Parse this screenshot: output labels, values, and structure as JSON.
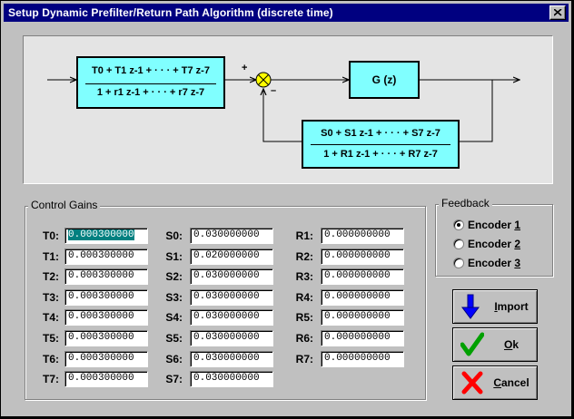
{
  "window": {
    "title": "Setup Dynamic Prefilter/Return Path Algorithm (discrete time)"
  },
  "diagram": {
    "prefilter_num": "T0 + T1 z-1 + · · · + T7 z-7",
    "prefilter_den": "1 + r1 z-1 + · · · + r7 z-7",
    "plant": "G (z)",
    "feedback_num": "S0 + S1 z-1 + · · · + S7 z-7",
    "feedback_den": "1 + R1 z-1 + · · · + R7 z-7",
    "plus_sign": "+",
    "minus_sign": "–",
    "block_color": "#80ffff"
  },
  "control_gains": {
    "label": "Control Gains",
    "T": [
      {
        "label": "T0:",
        "value": "0.000300000"
      },
      {
        "label": "T1:",
        "value": "0.000300000"
      },
      {
        "label": "T2:",
        "value": "0.000300000"
      },
      {
        "label": "T3:",
        "value": "0.000300000"
      },
      {
        "label": "T4:",
        "value": "0.000300000"
      },
      {
        "label": "T5:",
        "value": "0.000300000"
      },
      {
        "label": "T6:",
        "value": "0.000300000"
      },
      {
        "label": "T7:",
        "value": "0.000300000"
      }
    ],
    "S": [
      {
        "label": "S0:",
        "value": "0.030000000"
      },
      {
        "label": "S1:",
        "value": "0.020000000"
      },
      {
        "label": "S2:",
        "value": "0.030000000"
      },
      {
        "label": "S3:",
        "value": "0.030000000"
      },
      {
        "label": "S4:",
        "value": "0.030000000"
      },
      {
        "label": "S5:",
        "value": "0.030000000"
      },
      {
        "label": "S6:",
        "value": "0.030000000"
      },
      {
        "label": "S7:",
        "value": "0.030000000"
      }
    ],
    "R": [
      {
        "label": "R1:",
        "value": "0.000000000"
      },
      {
        "label": "R2:",
        "value": "0.000000000"
      },
      {
        "label": "R3:",
        "value": "0.000000000"
      },
      {
        "label": "R4:",
        "value": "0.000000000"
      },
      {
        "label": "R5:",
        "value": "0.000000000"
      },
      {
        "label": "R6:",
        "value": "0.000000000"
      },
      {
        "label": "R7:",
        "value": "0.000000000"
      }
    ]
  },
  "feedback": {
    "label": "Feedback",
    "options": [
      {
        "text": "Encoder ",
        "key": "1",
        "selected": true
      },
      {
        "text": "Encoder ",
        "key": "2",
        "selected": false
      },
      {
        "text": "Encoder ",
        "key": "3",
        "selected": false
      }
    ]
  },
  "buttons": {
    "import": {
      "pre": "",
      "key": "I",
      "post": "mport",
      "icon": "down-arrow-icon",
      "color": "#0000ff"
    },
    "ok": {
      "pre": "",
      "key": "O",
      "post": "k",
      "icon": "checkmark-icon",
      "color": "#00a000"
    },
    "cancel": {
      "pre": "",
      "key": "C",
      "post": "ancel",
      "icon": "x-cross-icon",
      "color": "#ff0000"
    }
  }
}
